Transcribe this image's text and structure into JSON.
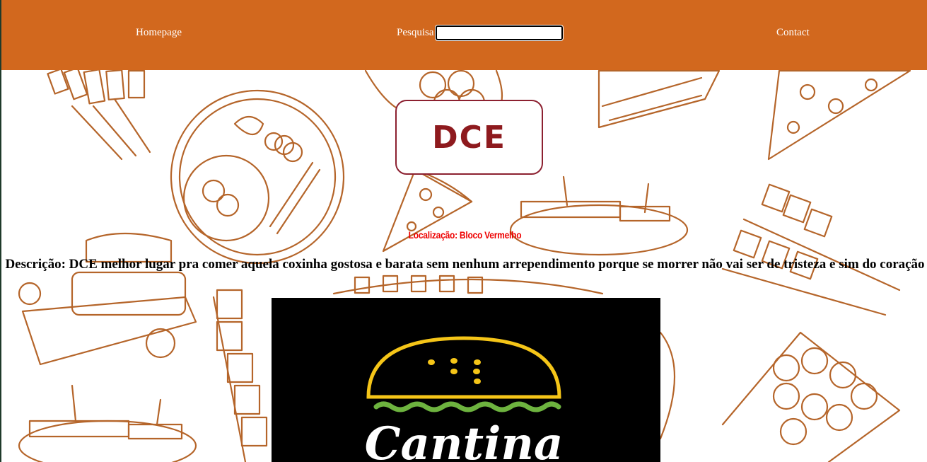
{
  "nav": {
    "home_label": "Homepage",
    "search_label": "Pesquisa",
    "search_value": "",
    "contact_label": "Contact"
  },
  "logo": {
    "text": "DCE"
  },
  "location": "Localização: Bloco Vermelho",
  "description": "Descrição: DCE melhor lugar pra comer aquela coxinha gostosa e barata sem nenhum arrependimento porque se morrer não vai ser de tristeza e sim do coração",
  "cantina_image": {
    "text": "Cantina"
  },
  "colors": {
    "navbar": "#d2681e",
    "nav_text": "#ffffff",
    "logo_text": "#8e1a1e",
    "logo_border": "#8c2030",
    "location_text": "#ee0000",
    "doodle": "#b5652a",
    "bun": "#f5c518",
    "lettuce": "#6db33f"
  }
}
